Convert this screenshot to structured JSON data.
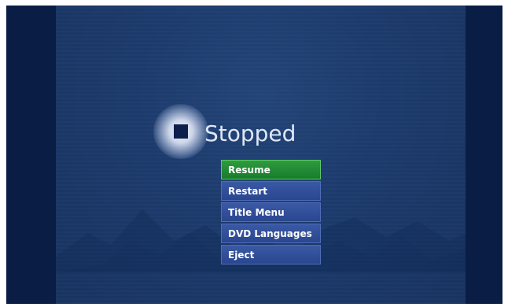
{
  "player": {
    "status": "Stopped",
    "status_icon": "stop-icon"
  },
  "menu": {
    "items": [
      {
        "label": "Resume",
        "selected": true
      },
      {
        "label": "Restart",
        "selected": false
      },
      {
        "label": "Title Menu",
        "selected": false
      },
      {
        "label": "DVD Languages",
        "selected": false
      },
      {
        "label": "Eject",
        "selected": false
      }
    ]
  },
  "colors": {
    "background": "#0d2350",
    "menu_item": "#2f4c96",
    "menu_selected": "#1f8a33",
    "status_text": "#dfe7f7"
  }
}
